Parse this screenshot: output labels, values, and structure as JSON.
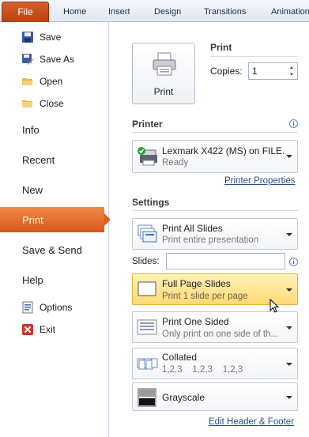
{
  "ribbon": {
    "tabs": [
      "File",
      "Home",
      "Insert",
      "Design",
      "Transitions",
      "Animation"
    ]
  },
  "nav": {
    "commands": [
      {
        "label": "Save",
        "icon": "save-icon"
      },
      {
        "label": "Save As",
        "icon": "save-as-icon"
      },
      {
        "label": "Open",
        "icon": "open-folder-icon"
      },
      {
        "label": "Close",
        "icon": "close-folder-icon"
      }
    ],
    "items": [
      "Info",
      "Recent",
      "New",
      "Print",
      "Save & Send",
      "Help"
    ],
    "selected": "Print",
    "bottom": [
      {
        "label": "Options",
        "icon": "options-icon"
      },
      {
        "label": "Exit",
        "icon": "exit-icon"
      }
    ]
  },
  "print": {
    "header": "Print",
    "button_label": "Print",
    "copies_label": "Copies:",
    "copies_value": "1"
  },
  "printer": {
    "header": "Printer",
    "name": "Lexmark X422 (MS) on FILE...",
    "status": "Ready",
    "properties_link": "Printer Properties"
  },
  "settings": {
    "header": "Settings",
    "slides_label": "Slides:",
    "slides_value": "",
    "options": [
      {
        "title": "Print All Slides",
        "subtitle": "Print entire presentation",
        "icon": "all-slides-icon"
      },
      {
        "title": "Full Page Slides",
        "subtitle": "Print 1 slide per page",
        "icon": "full-page-slide-icon",
        "highlighted": true
      },
      {
        "title": "Print One Sided",
        "subtitle": "Only print on one side of th...",
        "icon": "one-sided-icon"
      },
      {
        "title": "Collated",
        "subtitle": "1,2,3    1,2,3    1,2,3",
        "icon": "collated-icon"
      },
      {
        "title": "Grayscale",
        "subtitle": "",
        "icon": "grayscale-icon"
      }
    ],
    "footer_link": "Edit Header & Footer"
  },
  "colors": {
    "file_tab": "#c44d16",
    "selected_nav": "#e46b29",
    "highlight": "#ffd974",
    "link": "#2a4c8a"
  }
}
